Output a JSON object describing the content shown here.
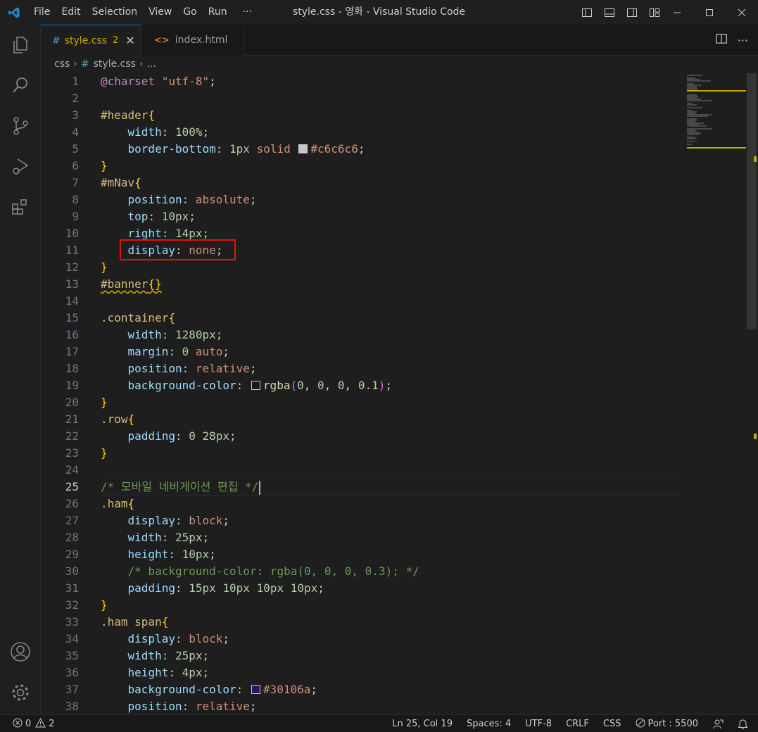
{
  "titlebar": {
    "menu": [
      "File",
      "Edit",
      "Selection",
      "View",
      "Go",
      "Run",
      "···"
    ],
    "title": "style.css - 영화 - Visual Studio Code"
  },
  "tabs": [
    {
      "label": "style.css",
      "badge": "2",
      "icon": "css-hash-icon",
      "active": true
    },
    {
      "label": "index.html",
      "icon": "html-icon",
      "active": false
    }
  ],
  "breadcrumb": {
    "folder": "css",
    "file": "style.css",
    "symbol": "..."
  },
  "editor": {
    "current_line": 25,
    "lines": [
      {
        "n": "1",
        "text": "@charset \"utf-8\";"
      },
      {
        "n": "2",
        "text": ""
      },
      {
        "n": "3",
        "text": "#header{"
      },
      {
        "n": "4",
        "text": "    width: 100%;"
      },
      {
        "n": "5",
        "text": "    border-bottom: 1px solid #c6c6c6;"
      },
      {
        "n": "6",
        "text": "}"
      },
      {
        "n": "7",
        "text": "#mNav{"
      },
      {
        "n": "8",
        "text": "    position: absolute;"
      },
      {
        "n": "9",
        "text": "    top: 10px;"
      },
      {
        "n": "10",
        "text": "    right: 14px;"
      },
      {
        "n": "11",
        "text": "    display: none;"
      },
      {
        "n": "12",
        "text": "}"
      },
      {
        "n": "13",
        "text": "#banner{}"
      },
      {
        "n": "14",
        "text": ""
      },
      {
        "n": "15",
        "text": ".container{"
      },
      {
        "n": "16",
        "text": "    width: 1280px;"
      },
      {
        "n": "17",
        "text": "    margin: 0 auto;"
      },
      {
        "n": "18",
        "text": "    position: relative;"
      },
      {
        "n": "19",
        "text": "    background-color: rgba(0, 0, 0, 0.1);"
      },
      {
        "n": "20",
        "text": "}"
      },
      {
        "n": "21",
        "text": ".row{"
      },
      {
        "n": "22",
        "text": "    padding: 0 28px;"
      },
      {
        "n": "23",
        "text": "}"
      },
      {
        "n": "24",
        "text": ""
      },
      {
        "n": "25",
        "text": "/* 모바일 네비게이션 편집 */"
      },
      {
        "n": "26",
        "text": ".ham{"
      },
      {
        "n": "27",
        "text": "    display: block;"
      },
      {
        "n": "28",
        "text": "    width: 25px;"
      },
      {
        "n": "29",
        "text": "    height: 10px;"
      },
      {
        "n": "30",
        "text": "    /* background-color: rgba(0, 0, 0, 0.3); */"
      },
      {
        "n": "31",
        "text": "    padding: 15px 10px 10px 10px;"
      },
      {
        "n": "32",
        "text": "}"
      },
      {
        "n": "33",
        "text": ".ham span{"
      },
      {
        "n": "34",
        "text": "    display: block;"
      },
      {
        "n": "35",
        "text": "    width: 25px;"
      },
      {
        "n": "36",
        "text": "    height: 4px;"
      },
      {
        "n": "37",
        "text": "    background-color: #30106a;"
      },
      {
        "n": "38",
        "text": "    position: relative;"
      }
    ],
    "swatches": {
      "line5": "#c6c6c6",
      "line19": "rgba(0,0,0,0.1)",
      "line37": "#30106a"
    }
  },
  "statusbar": {
    "errors": "0",
    "warnings": "2",
    "position": "Ln 25, Col 19",
    "spaces": "Spaces: 4",
    "encoding": "UTF-8",
    "eol": "CRLF",
    "language": "CSS",
    "port": "Port : 5500"
  },
  "colors": {
    "accent": "#0078d4",
    "warning": "#cca700",
    "highlight_box": "#e51400"
  }
}
